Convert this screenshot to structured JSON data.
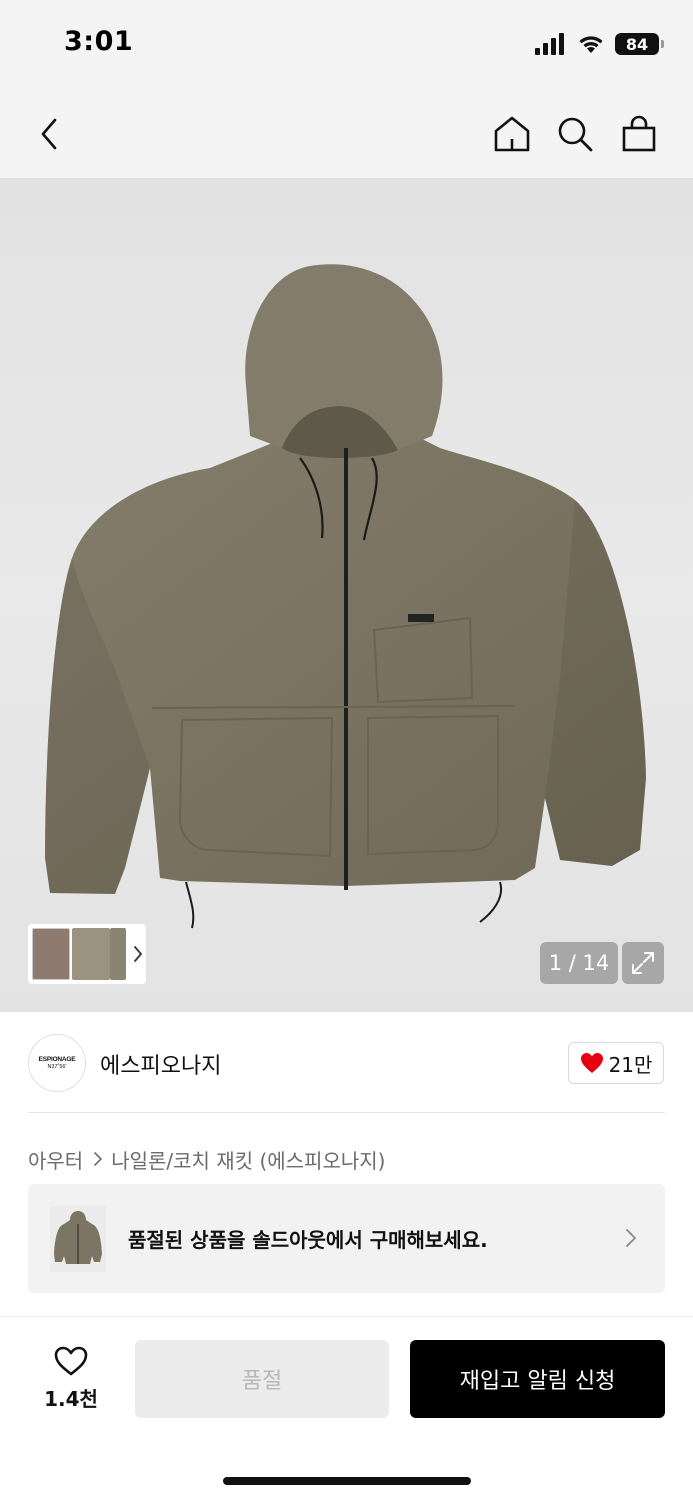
{
  "status_bar": {
    "time": "3:01",
    "battery": "84"
  },
  "nav": {
    "back_icon": "chevron-left-icon",
    "home_icon": "home-icon",
    "search_icon": "search-icon",
    "bag_icon": "shopping-bag-icon"
  },
  "gallery": {
    "counter": "1 / 14",
    "expand_icon": "expand-icon",
    "thumb_chevron_icon": "chevron-right-icon"
  },
  "brand": {
    "logo_text": "ESPIONAGE",
    "logo_subtext": "N37˚56'",
    "name": "에스피오나지",
    "likes": "21만",
    "heart_color": "#e60012"
  },
  "breadcrumb": {
    "category": "아우터",
    "subcategory": "나일론/코치 재킷 (에스피오나지)"
  },
  "soldout_banner": {
    "text": "품절된 상품을 솔드아웃에서 구매해보세요."
  },
  "bottom": {
    "wish_count": "1.4천",
    "soldout_label": "품절",
    "restock_label": "재입고 알림 신청"
  },
  "colors": {
    "jacket": "#7d7563",
    "primary_button": "#000000",
    "disabled_button": "#ececec"
  }
}
